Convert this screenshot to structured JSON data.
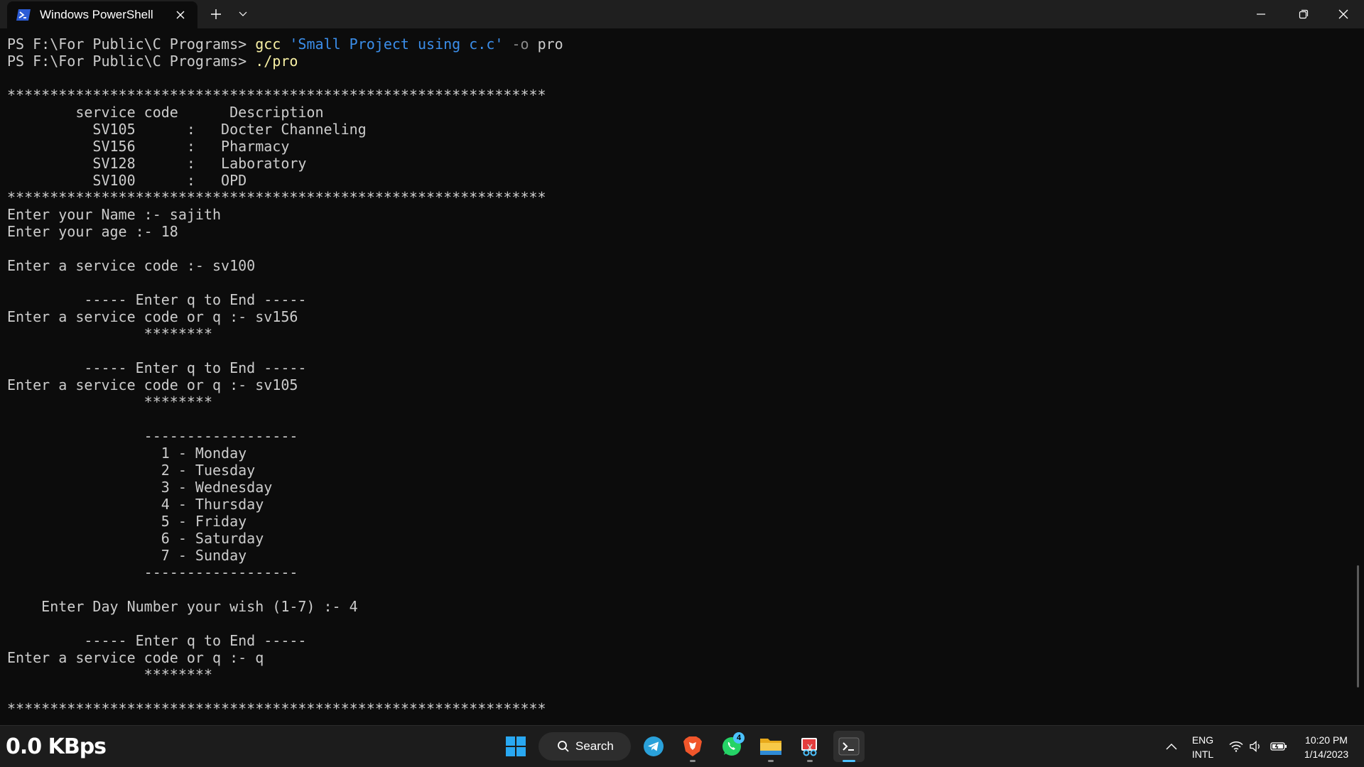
{
  "window": {
    "tab_title": "Windows PowerShell",
    "tab_icon": "powershell-icon",
    "buttons": [
      "new-tab-icon",
      "chevron-down-icon",
      "minimize-icon",
      "maximize-icon",
      "close-icon"
    ]
  },
  "terminal": {
    "colors": {
      "background": "#0c0c0c",
      "text": "#cccccc",
      "command": "#f9f1a5",
      "string": "#3b8eea",
      "parameter": "#8a8a8a"
    },
    "prompt": "PS F:\\For Public\\C Programs> ",
    "commands": [
      {
        "cmd": "gcc",
        "arg1": " 'Small Project using c.c'",
        "param": " -o",
        "arg2": " pro"
      },
      {
        "cmd": "./pro"
      }
    ],
    "output_lines": [
      "",
      "***************************************************************",
      "        service code      Description",
      "          SV105      :   Docter Channeling",
      "          SV156      :   Pharmacy",
      "          SV128      :   Laboratory",
      "          SV100      :   OPD",
      "***************************************************************",
      "Enter your Name :- sajith",
      "Enter your age :- 18",
      "",
      "Enter a service code :- sv100",
      "",
      "         ----- Enter q to End -----",
      "Enter a service code or q :- sv156",
      "                ********",
      "",
      "         ----- Enter q to End -----",
      "Enter a service code or q :- sv105",
      "                ********",
      "",
      "                ------------------",
      "                  1 - Monday",
      "                  2 - Tuesday",
      "                  3 - Wednesday",
      "                  4 - Thursday",
      "                  5 - Friday",
      "                  6 - Saturday",
      "                  7 - Sunday",
      "                ------------------",
      "",
      "    Enter Day Number your wish (1-7) :- 4",
      "",
      "         ----- Enter q to End -----",
      "Enter a service code or q :- q",
      "                ********",
      "",
      "***************************************************************"
    ]
  },
  "taskbar": {
    "net_speed": "0.0 KBps",
    "search_label": "Search",
    "apps": [
      {
        "name": "start-icon"
      },
      {
        "name": "telegram-icon"
      },
      {
        "name": "brave-icon"
      },
      {
        "name": "whatsapp-icon",
        "badge": "4"
      },
      {
        "name": "file-explorer-icon"
      },
      {
        "name": "snipping-tool-icon"
      },
      {
        "name": "terminal-icon",
        "active": true
      }
    ],
    "tray": {
      "lang_line1": "ENG",
      "lang_line2": "INTL",
      "time": "10:20 PM",
      "date": "1/14/2023"
    }
  }
}
